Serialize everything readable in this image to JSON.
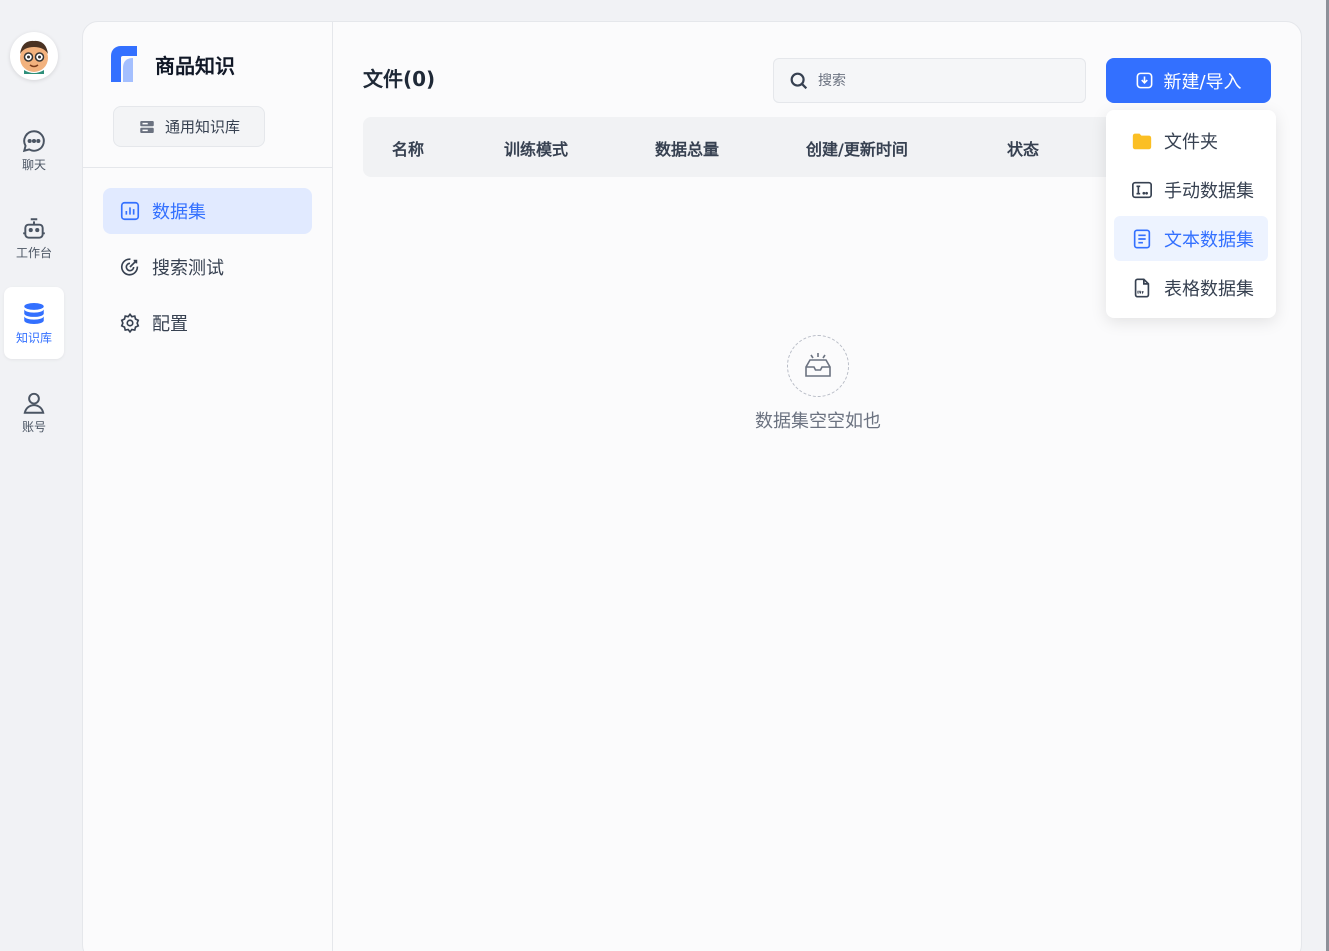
{
  "nav": {
    "items": [
      {
        "label": "聊天",
        "icon": "chat-icon"
      },
      {
        "label": "工作台",
        "icon": "robot-icon"
      },
      {
        "label": "知识库",
        "icon": "database-icon",
        "active": true
      },
      {
        "label": "账号",
        "icon": "user-icon"
      }
    ]
  },
  "knowledge_base": {
    "title": "商品知识",
    "type_label": "通用知识库"
  },
  "sidebar": {
    "items": [
      {
        "label": "数据集",
        "icon": "bar-chart-icon",
        "active": true
      },
      {
        "label": "搜索测试",
        "icon": "target-icon"
      },
      {
        "label": "配置",
        "icon": "gear-icon"
      }
    ]
  },
  "main": {
    "files_title": "文件(0)",
    "search_placeholder": "搜索",
    "new_button_label": "新建/导入",
    "columns": [
      "名称",
      "训练模式",
      "数据总量",
      "创建/更新时间",
      "状态"
    ],
    "empty_text": "数据集空空如也"
  },
  "dropdown": {
    "items": [
      {
        "label": "文件夹",
        "icon": "folder-icon"
      },
      {
        "label": "手动数据集",
        "icon": "manual-input-icon"
      },
      {
        "label": "文本数据集",
        "icon": "text-file-icon",
        "active": true
      },
      {
        "label": "表格数据集",
        "icon": "csv-file-icon"
      }
    ]
  },
  "colors": {
    "accent": "#3370ff",
    "folder": "#fbbf24",
    "active_bg": "#e1eaff"
  }
}
